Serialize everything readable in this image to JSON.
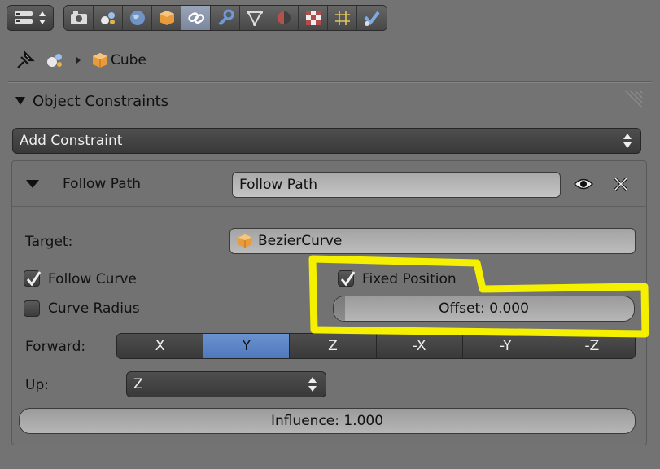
{
  "breadcrumb": {
    "object": "Cube"
  },
  "panel": {
    "title": "Object Constraints"
  },
  "add_constraint": {
    "label": "Add Constraint"
  },
  "constraint": {
    "type": "Follow Path",
    "name": "Follow Path",
    "target_label": "Target:",
    "target_value": "BezierCurve",
    "follow_curve_label": "Follow Curve",
    "follow_curve_checked": true,
    "curve_radius_label": "Curve Radius",
    "curve_radius_checked": false,
    "fixed_position_label": "Fixed Position",
    "fixed_position_checked": true,
    "offset_label": "Offset: 0.000",
    "forward_label": "Forward:",
    "forward_options": [
      "X",
      "Y",
      "Z",
      "-X",
      "-Y",
      "-Z"
    ],
    "forward_selected": "Y",
    "up_label": "Up:",
    "up_value": "Z",
    "influence_label": "Influence: 1.000"
  },
  "toolbar_tabs": [
    "render-icon",
    "scene-icon",
    "world-icon",
    "object-icon",
    "constraints-icon",
    "modifiers-icon",
    "data-icon",
    "material-icon",
    "texture-icon",
    "particles-icon",
    "physics-icon"
  ],
  "colors": {
    "accent": "#5b84c6",
    "annotation": "#f5f000"
  }
}
